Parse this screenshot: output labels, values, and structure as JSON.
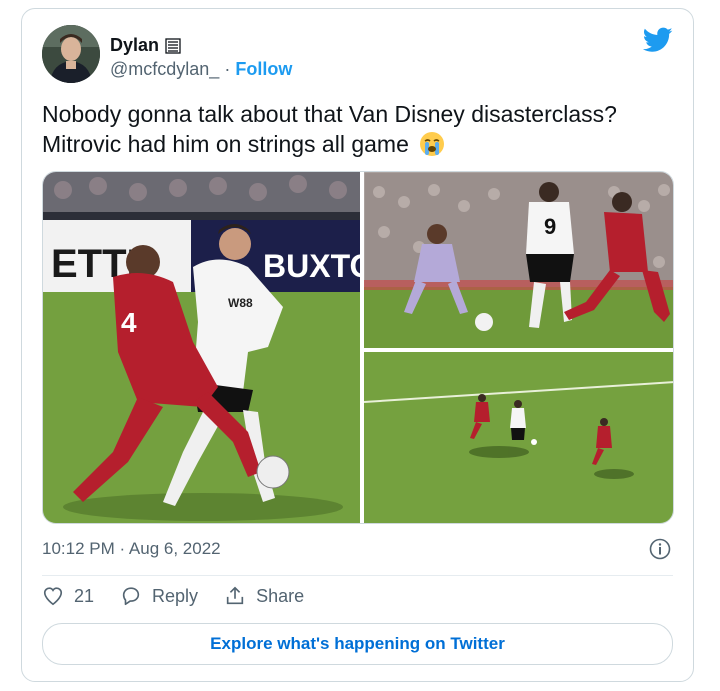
{
  "author": {
    "display_name": "Dylan",
    "handle": "@mcfcdylan_",
    "separator": "·",
    "follow_label": "Follow",
    "avatar_icon": "profile-avatar",
    "name_glyph_icon": "list-glyph-icon"
  },
  "brand_icon": "twitter-bird-icon",
  "tweet": {
    "text": "Nobody gonna talk about that Van Disney disasterclass? Mitrovic had him on strings all game",
    "emoji_icon": "loudly-crying-face-emoji",
    "media": [
      {
        "name": "photo-tackle-closeup",
        "sign_text": "ETTE",
        "sign_text2": "BUXTO",
        "shirt_number": "4",
        "sponsor": "W88"
      },
      {
        "name": "photo-goalmouth",
        "shirt_number": "9"
      },
      {
        "name": "photo-wide-pitch"
      }
    ]
  },
  "meta": {
    "timestamp": "10:12 PM · Aug 6, 2022",
    "info_icon": "info-icon"
  },
  "actions": {
    "like_count": "21",
    "reply_label": "Reply",
    "share_label": "Share"
  },
  "explore_label": "Explore what's happening on Twitter",
  "colors": {
    "twitter_blue": "#1d9bf0",
    "link_blue": "#006fd6",
    "secondary_text": "#536471",
    "border": "#cfd9de",
    "pitch_green": "#6f9a3a",
    "liverpool_red": "#b51f2d"
  }
}
